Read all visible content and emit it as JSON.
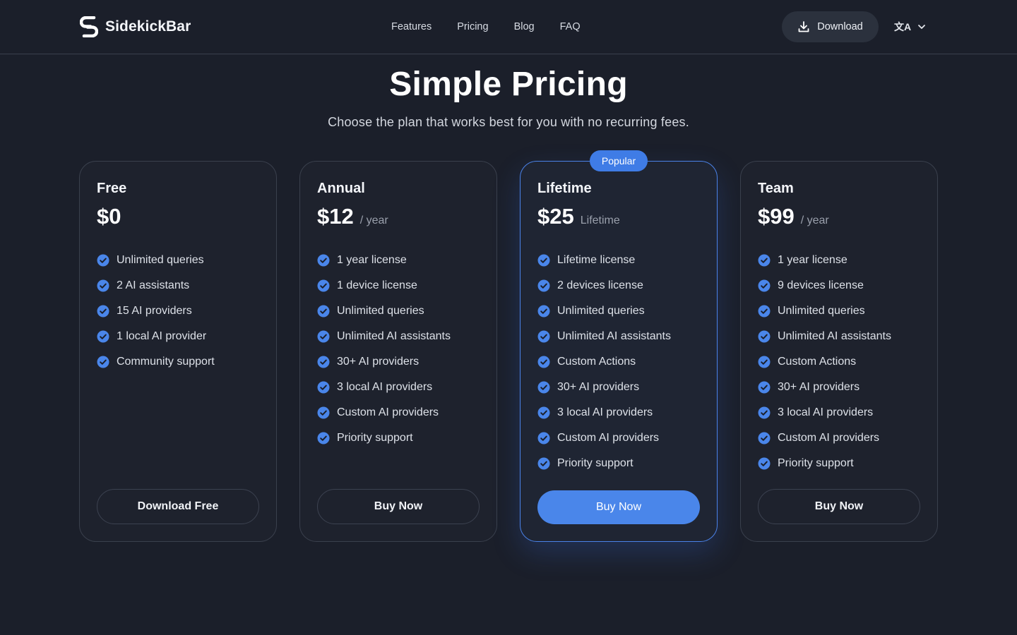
{
  "header": {
    "brand_name": "SidekickBar",
    "nav": [
      "Features",
      "Pricing",
      "Blog",
      "FAQ"
    ],
    "download_label": "Download",
    "lang_icon_glyph": "文A"
  },
  "hero": {
    "title": "Simple Pricing",
    "subtitle": "Choose the plan that works best for you with no recurring fees."
  },
  "colors": {
    "accent": "#4a86ea",
    "background": "#1b1f2a"
  },
  "plans": [
    {
      "name": "Free",
      "price": "$0",
      "period": "",
      "features": [
        "Unlimited queries",
        "2 AI assistants",
        "15 AI providers",
        "1 local AI provider",
        "Community support"
      ],
      "cta": "Download Free"
    },
    {
      "name": "Annual",
      "price": "$12",
      "period": "/ year",
      "features": [
        "1 year license",
        "1 device license",
        "Unlimited queries",
        "Unlimited AI assistants",
        "30+ AI providers",
        "3 local AI providers",
        "Custom AI providers",
        "Priority support"
      ],
      "cta": "Buy Now"
    },
    {
      "name": "Lifetime",
      "badge": "Popular",
      "price": "$25",
      "period": "Lifetime",
      "features": [
        "Lifetime license",
        "2 devices license",
        "Unlimited queries",
        "Unlimited AI assistants",
        "Custom Actions",
        "30+ AI providers",
        "3 local AI providers",
        "Custom AI providers",
        "Priority support"
      ],
      "cta": "Buy Now"
    },
    {
      "name": "Team",
      "price": "$99",
      "period": "/ year",
      "features": [
        "1 year license",
        "9 devices license",
        "Unlimited queries",
        "Unlimited AI assistants",
        "Custom Actions",
        "30+ AI providers",
        "3 local AI providers",
        "Custom AI providers",
        "Priority support"
      ],
      "cta": "Buy Now"
    }
  ]
}
